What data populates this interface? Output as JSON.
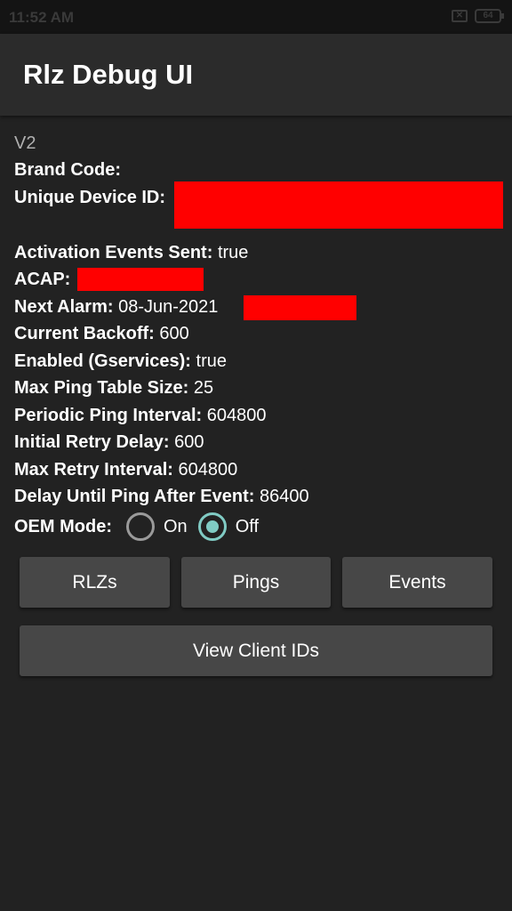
{
  "status_bar": {
    "time": "11:52 AM",
    "battery": "64",
    "sim_icon": "sim-off-icon"
  },
  "app_bar": {
    "title": "Rlz Debug UI"
  },
  "content": {
    "version": "V2",
    "rows": [
      {
        "label": "Brand Code:",
        "value": ""
      },
      {
        "label": "Unique Device ID:",
        "value": ""
      },
      {
        "label": "Activation Events Sent:",
        "value": "true"
      },
      {
        "label": "ACAP:",
        "value": ""
      },
      {
        "label": "Next Alarm:",
        "value": "08-Jun-2021"
      },
      {
        "label": "Current Backoff:",
        "value": "600"
      },
      {
        "label": "Enabled (Gservices):",
        "value": "true"
      },
      {
        "label": "Max Ping Table Size:",
        "value": "25"
      },
      {
        "label": "Periodic Ping Interval:",
        "value": "604800"
      },
      {
        "label": "Initial Retry Delay:",
        "value": "600"
      },
      {
        "label": "Max Retry Interval:",
        "value": "604800"
      },
      {
        "label": "Delay Until Ping After Event:",
        "value": "86400"
      }
    ],
    "redaction_color": "#ff0000"
  },
  "oem_mode": {
    "label": "OEM Mode:",
    "options": [
      "On",
      "Off"
    ],
    "selected": "Off",
    "accent": "#80cbc4"
  },
  "buttons": {
    "rlzs": "RLZs",
    "pings": "Pings",
    "events": "Events",
    "view_client_ids": "View Client IDs"
  }
}
